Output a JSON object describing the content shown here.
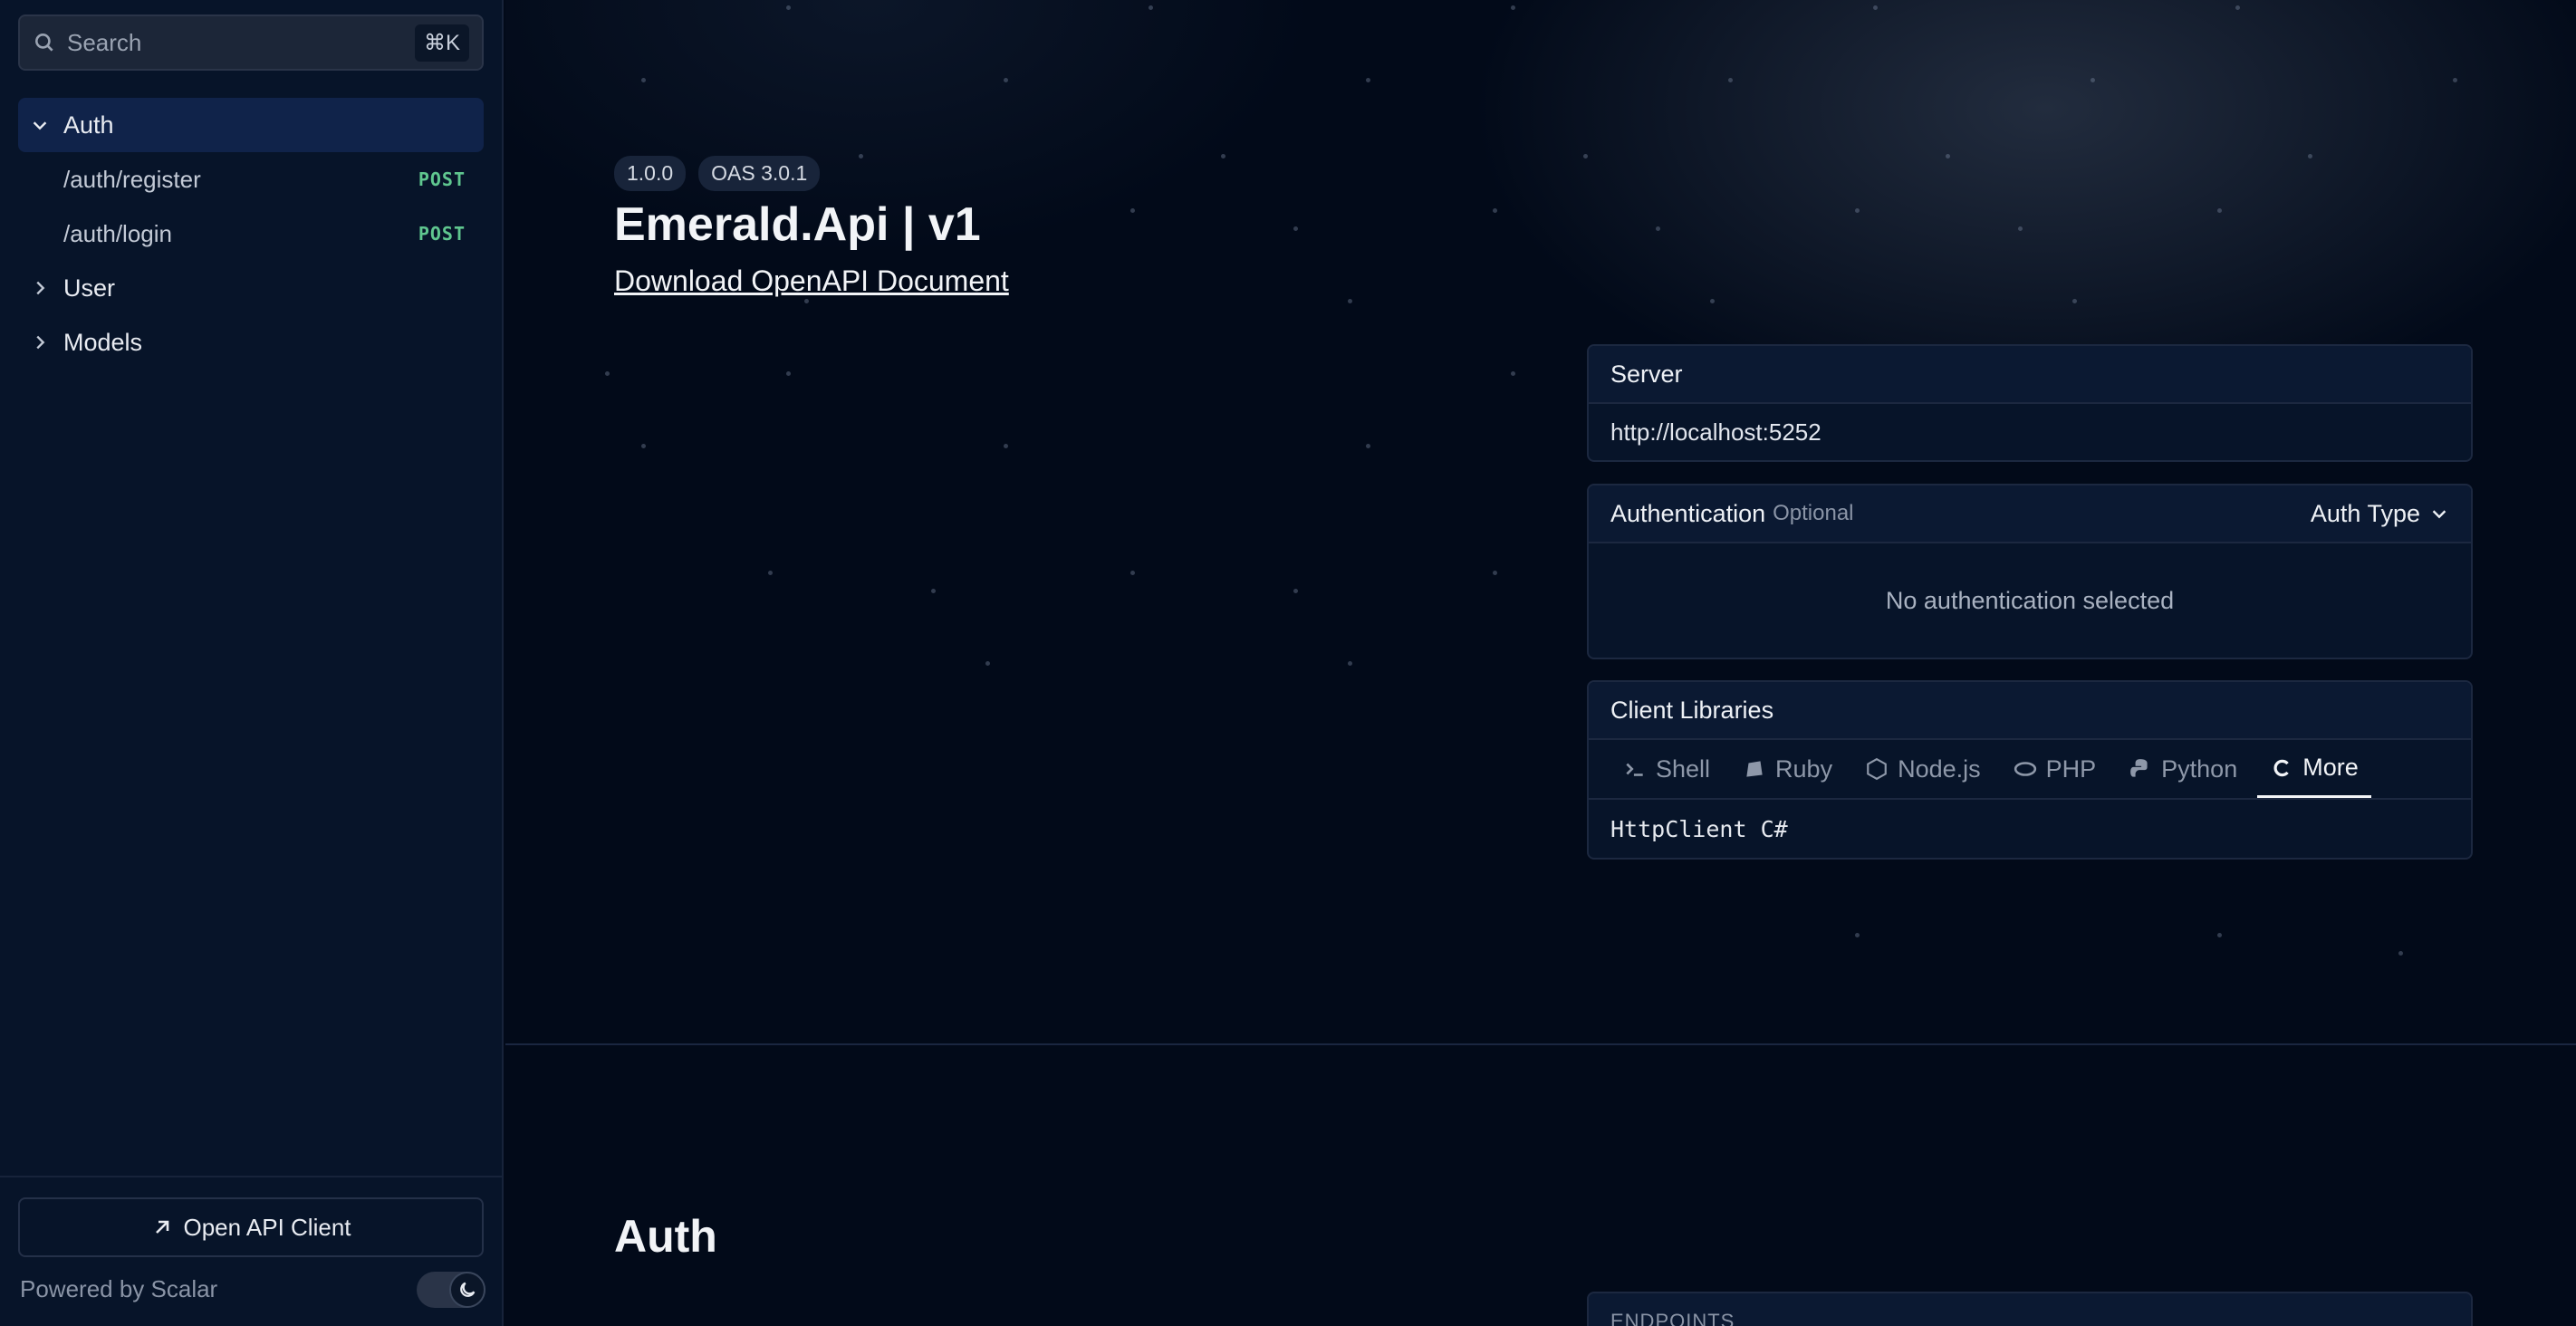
{
  "sidebar": {
    "search": {
      "placeholder": "Search",
      "shortcut": "⌘K"
    },
    "groups": [
      {
        "label": "Auth",
        "expanded": true,
        "items": [
          {
            "path": "/auth/register",
            "method": "POST"
          },
          {
            "path": "/auth/login",
            "method": "POST"
          }
        ]
      },
      {
        "label": "User",
        "expanded": false
      },
      {
        "label": "Models",
        "expanded": false
      }
    ],
    "open_client_label": "Open API Client",
    "powered_by": "Powered by Scalar"
  },
  "header": {
    "badges": [
      "1.0.0",
      "OAS 3.0.1"
    ],
    "title": "Emerald.Api | v1",
    "download_label": "Download OpenAPI Document"
  },
  "server": {
    "heading": "Server",
    "url": "http://localhost:5252"
  },
  "authentication": {
    "heading": "Authentication",
    "optional_label": "Optional",
    "auth_type_label": "Auth Type",
    "empty_state": "No authentication selected"
  },
  "client_libraries": {
    "heading": "Client Libraries",
    "tabs": [
      "Shell",
      "Ruby",
      "Node.js",
      "PHP",
      "Python",
      "More"
    ],
    "active_tab": "More",
    "selected_client": "HttpClient C#"
  },
  "section": {
    "title": "Auth",
    "endpoints_label": "ENDPOINTS"
  },
  "colors": {
    "background": "#020a19",
    "sidebar": "#071429",
    "method_post": "#5fc68f",
    "active_nav": "#10234a"
  }
}
